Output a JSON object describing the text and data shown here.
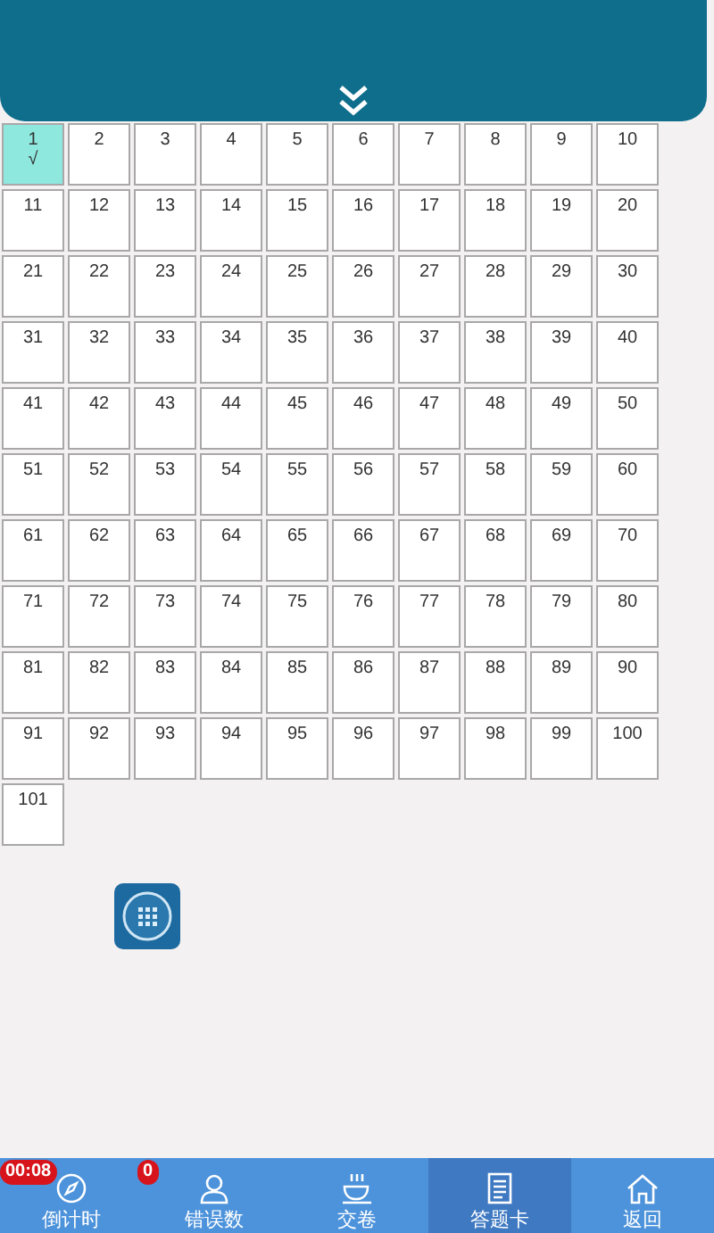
{
  "cells": [
    {
      "number": "1",
      "answered": true,
      "mark": "√"
    },
    {
      "number": "2",
      "answered": false
    },
    {
      "number": "3",
      "answered": false
    },
    {
      "number": "4",
      "answered": false
    },
    {
      "number": "5",
      "answered": false
    },
    {
      "number": "6",
      "answered": false
    },
    {
      "number": "7",
      "answered": false
    },
    {
      "number": "8",
      "answered": false
    },
    {
      "number": "9",
      "answered": false
    },
    {
      "number": "10",
      "answered": false
    },
    {
      "number": "11",
      "answered": false
    },
    {
      "number": "12",
      "answered": false
    },
    {
      "number": "13",
      "answered": false
    },
    {
      "number": "14",
      "answered": false
    },
    {
      "number": "15",
      "answered": false
    },
    {
      "number": "16",
      "answered": false
    },
    {
      "number": "17",
      "answered": false
    },
    {
      "number": "18",
      "answered": false
    },
    {
      "number": "19",
      "answered": false
    },
    {
      "number": "20",
      "answered": false
    },
    {
      "number": "21",
      "answered": false
    },
    {
      "number": "22",
      "answered": false
    },
    {
      "number": "23",
      "answered": false
    },
    {
      "number": "24",
      "answered": false
    },
    {
      "number": "25",
      "answered": false
    },
    {
      "number": "26",
      "answered": false
    },
    {
      "number": "27",
      "answered": false
    },
    {
      "number": "28",
      "answered": false
    },
    {
      "number": "29",
      "answered": false
    },
    {
      "number": "30",
      "answered": false
    },
    {
      "number": "31",
      "answered": false
    },
    {
      "number": "32",
      "answered": false
    },
    {
      "number": "33",
      "answered": false
    },
    {
      "number": "34",
      "answered": false
    },
    {
      "number": "35",
      "answered": false
    },
    {
      "number": "36",
      "answered": false
    },
    {
      "number": "37",
      "answered": false
    },
    {
      "number": "38",
      "answered": false
    },
    {
      "number": "39",
      "answered": false
    },
    {
      "number": "40",
      "answered": false
    },
    {
      "number": "41",
      "answered": false
    },
    {
      "number": "42",
      "answered": false
    },
    {
      "number": "43",
      "answered": false
    },
    {
      "number": "44",
      "answered": false
    },
    {
      "number": "45",
      "answered": false
    },
    {
      "number": "46",
      "answered": false
    },
    {
      "number": "47",
      "answered": false
    },
    {
      "number": "48",
      "answered": false
    },
    {
      "number": "49",
      "answered": false
    },
    {
      "number": "50",
      "answered": false
    },
    {
      "number": "51",
      "answered": false
    },
    {
      "number": "52",
      "answered": false
    },
    {
      "number": "53",
      "answered": false
    },
    {
      "number": "54",
      "answered": false
    },
    {
      "number": "55",
      "answered": false
    },
    {
      "number": "56",
      "answered": false
    },
    {
      "number": "57",
      "answered": false
    },
    {
      "number": "58",
      "answered": false
    },
    {
      "number": "59",
      "answered": false
    },
    {
      "number": "60",
      "answered": false
    },
    {
      "number": "61",
      "answered": false
    },
    {
      "number": "62",
      "answered": false
    },
    {
      "number": "63",
      "answered": false
    },
    {
      "number": "64",
      "answered": false
    },
    {
      "number": "65",
      "answered": false
    },
    {
      "number": "66",
      "answered": false
    },
    {
      "number": "67",
      "answered": false
    },
    {
      "number": "68",
      "answered": false
    },
    {
      "number": "69",
      "answered": false
    },
    {
      "number": "70",
      "answered": false
    },
    {
      "number": "71",
      "answered": false
    },
    {
      "number": "72",
      "answered": false
    },
    {
      "number": "73",
      "answered": false
    },
    {
      "number": "74",
      "answered": false
    },
    {
      "number": "75",
      "answered": false
    },
    {
      "number": "76",
      "answered": false
    },
    {
      "number": "77",
      "answered": false
    },
    {
      "number": "78",
      "answered": false
    },
    {
      "number": "79",
      "answered": false
    },
    {
      "number": "80",
      "answered": false
    },
    {
      "number": "81",
      "answered": false
    },
    {
      "number": "82",
      "answered": false
    },
    {
      "number": "83",
      "answered": false
    },
    {
      "number": "84",
      "answered": false
    },
    {
      "number": "85",
      "answered": false
    },
    {
      "number": "86",
      "answered": false
    },
    {
      "number": "87",
      "answered": false
    },
    {
      "number": "88",
      "answered": false
    },
    {
      "number": "89",
      "answered": false
    },
    {
      "number": "90",
      "answered": false
    },
    {
      "number": "91",
      "answered": false
    },
    {
      "number": "92",
      "answered": false
    },
    {
      "number": "93",
      "answered": false
    },
    {
      "number": "94",
      "answered": false
    },
    {
      "number": "95",
      "answered": false
    },
    {
      "number": "96",
      "answered": false
    },
    {
      "number": "97",
      "answered": false
    },
    {
      "number": "98",
      "answered": false
    },
    {
      "number": "99",
      "answered": false
    },
    {
      "number": "100",
      "answered": false
    },
    {
      "number": "101",
      "answered": false
    }
  ],
  "nav": [
    {
      "kind": "timer",
      "label": "倒计时",
      "badge": "00:08",
      "selected": false
    },
    {
      "kind": "person",
      "label": "错误数",
      "badge": "0",
      "selected": false
    },
    {
      "kind": "cup",
      "label": "交卷",
      "selected": false
    },
    {
      "kind": "sheet",
      "label": "答题卡",
      "selected": true
    },
    {
      "kind": "home",
      "label": "返回",
      "selected": false
    }
  ]
}
